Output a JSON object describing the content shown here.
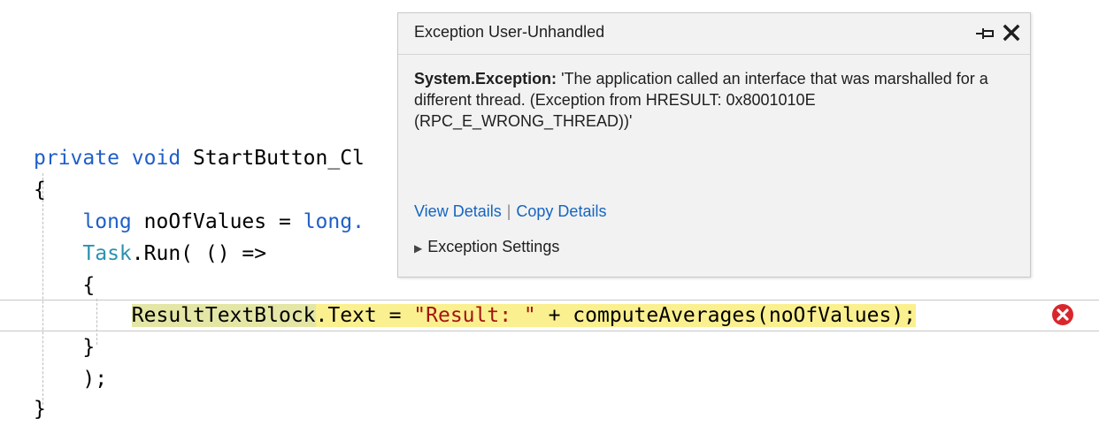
{
  "code": {
    "line1": {
      "kw1": "private",
      "kw2": "void",
      "name": "StartButton_Cl"
    },
    "line2": {
      "brace": "{"
    },
    "line3": {
      "kw": "long",
      "var": "noOfValues",
      "eq": "=",
      "type": "long."
    },
    "line4": {
      "type": "Task",
      "rest": ".Run( () =>"
    },
    "line5": {
      "brace": "{"
    },
    "line6": {
      "obj": "ResultTextBlock",
      "prop": ".Text = ",
      "str": "\"Result: \"",
      "rest": " + computeAverages(noOfValues);"
    },
    "line7": {
      "brace": "}"
    },
    "line8": {
      "text": ");"
    },
    "line9": {
      "brace": "}"
    }
  },
  "popup": {
    "title": "Exception User-Unhandled",
    "exception_type": "System.Exception:",
    "message": "'The application called an interface that was marshalled for a different thread. (Exception from HRESULT: 0x8001010E (RPC_E_WRONG_THREAD))'",
    "view_details": "View Details",
    "separator": "|",
    "copy_details": "Copy Details",
    "settings": "Exception Settings",
    "settings_expander": "▶"
  },
  "icons": {
    "pin": "pin-icon",
    "close": "close-icon",
    "error": "error-icon"
  },
  "colors": {
    "keyword": "#1f5fc8",
    "type": "#2b91af",
    "string": "#a31515",
    "highlight": "#fbf08f",
    "highlight_object": "#e4e6a6",
    "link": "#1565c0",
    "error": "#d9262c",
    "popup_bg": "#f2f2f2"
  }
}
